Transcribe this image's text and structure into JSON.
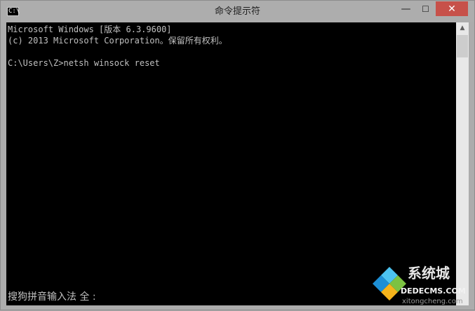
{
  "window": {
    "title": "命令提示符",
    "icon": "cmd-icon",
    "icon_label": "C:\\",
    "controls": {
      "minimize": "—",
      "maximize": "☐",
      "close": "✕"
    }
  },
  "console": {
    "lines": [
      "Microsoft Windows [版本 6.3.9600]",
      "(c) 2013 Microsoft Corporation。保留所有权利。",
      "",
      "C:\\Users\\Z>netsh winsock reset"
    ],
    "ime_status": "搜狗拼音输入法 全 :"
  },
  "scrollbar": {
    "up_arrow": "▲"
  },
  "watermark": {
    "brand": "系统城",
    "domain": "DEDECMS.COM",
    "url": "xitongcheng.com",
    "colors": {
      "blue": "#1d8fd6",
      "cyan": "#4cc3f0",
      "green": "#7cc242",
      "yellow": "#f5b41b"
    }
  },
  "colors": {
    "console_bg": "#000000",
    "console_text": "#c0c0c0",
    "titlebar": "#adadad",
    "close_button": "#c7514a"
  }
}
